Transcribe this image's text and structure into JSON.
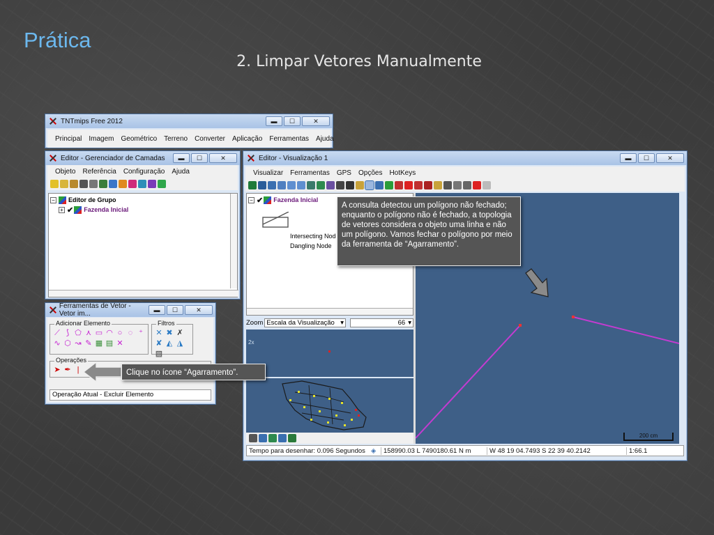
{
  "slide": {
    "title": "Prática",
    "subtitle": "2. Limpar Vetores Manualmente"
  },
  "main_window": {
    "title": "TNTmips Free 2012",
    "menu": [
      "Principal",
      "Imagem",
      "Geométrico",
      "Terreno",
      "Converter",
      "Aplicação",
      "Ferramentas",
      "Ajuda"
    ]
  },
  "layer_manager": {
    "title": "Editor - Gerenciador de Camadas",
    "menu": [
      "Objeto",
      "Referência",
      "Configuração",
      "Ajuda"
    ],
    "tree": {
      "group": "Editor de Grupo",
      "layer": "Fazenda Inicial"
    }
  },
  "vector_tools": {
    "title": "Ferramentas de Vetor - Vetor im...",
    "add_group_label": "Adicionar Elemento",
    "filters_label": "Filtros",
    "operations_label": "Operações",
    "status": "Operação Atual - Excluir Elemento"
  },
  "view_window": {
    "title": "Editor - Visualização 1",
    "menu": [
      "Visualizar",
      "Ferramentas",
      "GPS",
      "Opções",
      "HotKeys"
    ],
    "legend_layer": "Fazenda Inicial",
    "legend_items": [
      "Intersecting Nod",
      "Dangling Node"
    ],
    "zoom_label": "Zoom",
    "zoom_select": "Escala da Visualização",
    "zoom_value": "66",
    "zoom_2x": "2x",
    "scale_bar_label": "200 cm",
    "status": {
      "draw_time": "Tempo para desenhar: 0.096 Segundos",
      "coords": "158990.03 L  7490180.61 N m",
      "latlon": "W 48 19 04.7493  S 22 39 40.2142",
      "scale": "1:66.1"
    }
  },
  "callouts": {
    "topology": "A consulta detectou um polígono não fechado; enquanto o polígono não é fechado, a topologia de vetores considera o objeto uma linha e não um polígono. Vamos fechar o polígono por meio da ferramenta de “Agarramento”.",
    "snap": "Clique no ícone “Agarramento”."
  },
  "window_controls": {
    "minimize": "▬",
    "maximize": "☐",
    "close": "✕"
  },
  "colors": {
    "title_blue": "#6cb8ee",
    "map_blue": "#3e5f87",
    "line_magenta": "#c43bd1",
    "callout_bg": "#555555"
  }
}
